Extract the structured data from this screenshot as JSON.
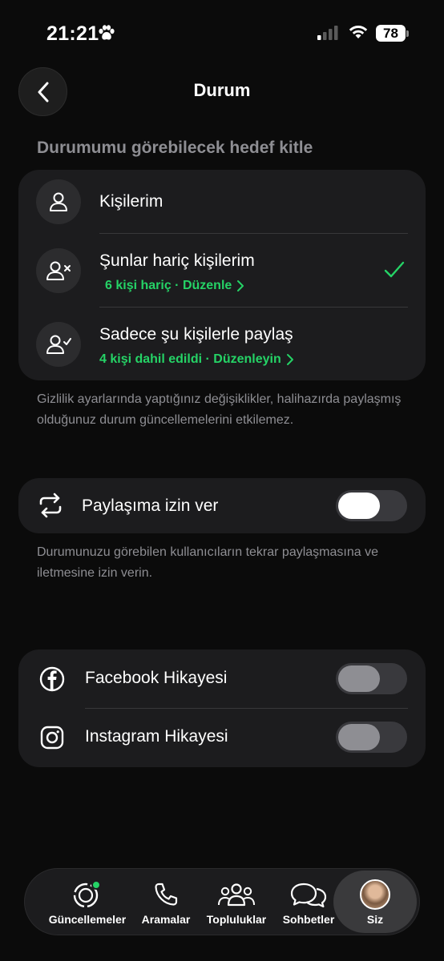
{
  "status_bar": {
    "time": "21:21",
    "battery": "78"
  },
  "header": {
    "title": "Durum"
  },
  "audience": {
    "section_title": "Durumumu görebilecek hedef kitle",
    "options": [
      {
        "label": "Kişilerim",
        "icon": "person-icon",
        "selected": false
      },
      {
        "label": "Şunlar hariç kişilerim",
        "sub": "6 kişi hariç · Düzenle",
        "icon": "person-x-icon",
        "selected": true
      },
      {
        "label": "Sadece şu kişilerle paylaş",
        "sub": "4 kişi dahil edildi · Düzenleyin",
        "icon": "person-check-icon",
        "selected": false
      }
    ],
    "footnote": "Gizlilik ayarlarında yaptığınız değişiklikler, halihazırda paylaşmış olduğunuz durum güncellemelerini etkilemez."
  },
  "resharing": {
    "label": "Paylaşıma izin ver",
    "icon": "repeat-icon",
    "enabled": false,
    "footnote": "Durumunuzu görebilen kullanıcıların tekrar paylaşmasına ve iletmesine izin verin."
  },
  "social": {
    "items": [
      {
        "label": "Facebook Hikayesi",
        "icon": "facebook-icon",
        "enabled": false
      },
      {
        "label": "Instagram Hikayesi",
        "icon": "instagram-icon",
        "enabled": false
      }
    ]
  },
  "tab_bar": {
    "tabs": [
      {
        "label": "Güncellemeler",
        "icon": "updates-icon"
      },
      {
        "label": "Aramalar",
        "icon": "phone-icon"
      },
      {
        "label": "Topluluklar",
        "icon": "communities-icon"
      },
      {
        "label": "Sohbetler",
        "icon": "chats-icon"
      },
      {
        "label": "Siz",
        "icon": "avatar",
        "selected": true
      }
    ]
  },
  "colors": {
    "accent": "#25d366",
    "background": "#0b0b0b",
    "card": "#1c1c1e"
  }
}
